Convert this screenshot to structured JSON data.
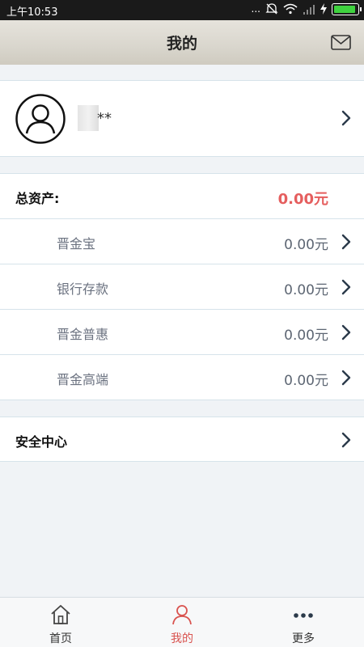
{
  "status_bar": {
    "time": "上午10:53",
    "signal_text": "...",
    "network_icons": [
      "mute-icon",
      "wifi-icon",
      "signal-icon",
      "charging-icon",
      "battery-icon"
    ]
  },
  "header": {
    "title": "我的",
    "mail_icon": "mail-icon"
  },
  "profile": {
    "name_suffix": "**"
  },
  "assets": {
    "total_label": "总资产:",
    "total_value": "0.00元",
    "items": [
      {
        "label": "晋金宝",
        "value": "0.00元"
      },
      {
        "label": "银行存款",
        "value": "0.00元"
      },
      {
        "label": "晋金普惠",
        "value": "0.00元"
      },
      {
        "label": "晋金高端",
        "value": "0.00元"
      }
    ]
  },
  "security": {
    "label": "安全中心"
  },
  "bottom_nav": {
    "items": [
      {
        "label": "首页",
        "icon": "home-icon",
        "active": false
      },
      {
        "label": "我的",
        "icon": "user-icon",
        "active": true
      },
      {
        "label": "更多",
        "icon": "more-icon",
        "active": false
      }
    ]
  },
  "colors": {
    "accent_red": "#e55e5e",
    "nav_active": "#d9534f",
    "battery": "#3fd23f"
  }
}
